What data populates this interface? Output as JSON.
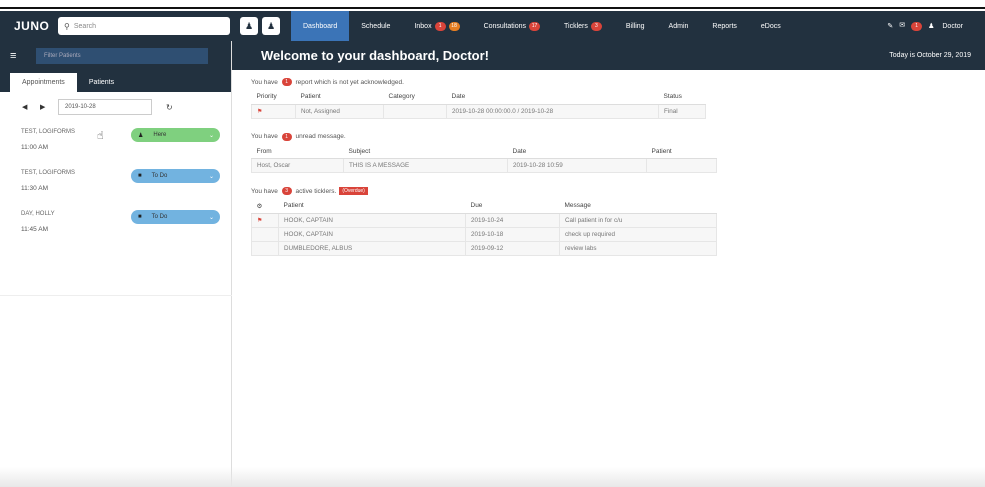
{
  "app": {
    "logo": "JUNO"
  },
  "topbar": {
    "search_placeholder": "Search",
    "nav": [
      {
        "label": "Dashboard",
        "active": true,
        "badges": []
      },
      {
        "label": "Schedule",
        "badges": []
      },
      {
        "label": "Inbox",
        "badges": [
          "1",
          "18"
        ]
      },
      {
        "label": "Consultations",
        "badges": [
          "17"
        ]
      },
      {
        "label": "Ticklers",
        "badges": [
          "3"
        ]
      },
      {
        "label": "Billing",
        "badges": []
      },
      {
        "label": "Admin",
        "badges": []
      },
      {
        "label": "Reports",
        "badges": []
      },
      {
        "label": "eDocs",
        "badges": []
      }
    ],
    "messages_badge": "1",
    "user_label": "Doctor"
  },
  "sidebar": {
    "filter_placeholder": "Filter Patients",
    "tabs": [
      "Appointments",
      "Patients"
    ],
    "date": "2019-10-28",
    "appointments": [
      {
        "name": "TEST, LOGIFORMS",
        "time": "11:00 AM",
        "status": "Here",
        "status_type": "here"
      },
      {
        "name": "TEST, LOGIFORMS",
        "time": "11:30 AM",
        "status": "To Do",
        "status_type": "todo"
      },
      {
        "name": "DAY, HOLLY",
        "time": "11:45 AM",
        "status": "To Do",
        "status_type": "todo"
      }
    ]
  },
  "main": {
    "welcome": "Welcome to your dashboard, Doctor!",
    "today": "Today is October 29, 2019",
    "reports": {
      "prefix": "You have",
      "count": "1",
      "suffix": "report which is not yet acknowledged.",
      "headers": [
        "Priority",
        "Patient",
        "Category",
        "Date",
        "Status"
      ],
      "rows": [
        {
          "flag": true,
          "patient": "Not, Assigned",
          "category": "",
          "date": "2019-10-28 00:00:00.0 / 2019-10-28",
          "status": "Final"
        }
      ]
    },
    "messages": {
      "prefix": "You have",
      "count": "1",
      "suffix": "unread message.",
      "headers": [
        "From",
        "Subject",
        "Date",
        "Patient"
      ],
      "rows": [
        {
          "from": "Host, Oscar",
          "subject": "THIS IS A MESSAGE",
          "date": "2019-10-28 10:59",
          "patient": ""
        }
      ]
    },
    "ticklers": {
      "prefix": "You have",
      "count": "3",
      "suffix": "active ticklers.",
      "overdue_label": "(Overdue)",
      "headers": [
        "Patient",
        "Due",
        "Message"
      ],
      "rows": [
        {
          "flag": true,
          "patient": "HOOK, CAPTAIN",
          "due": "2019-10-24",
          "message": "Call patient in for c/u"
        },
        {
          "flag": false,
          "patient": "HOOK, CAPTAIN",
          "due": "2019-10-18",
          "message": "check up required"
        },
        {
          "flag": false,
          "patient": "DUMBLEDORE, ALBUS",
          "due": "2019-09-12",
          "message": "review labs"
        }
      ]
    }
  }
}
